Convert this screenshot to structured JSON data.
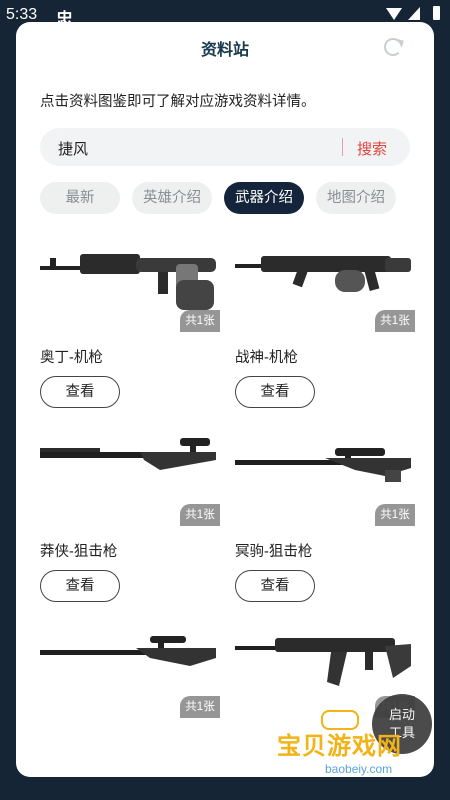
{
  "status": {
    "time": "5:33",
    "app_icon": "忠"
  },
  "header": {
    "title": "资料站"
  },
  "desc": "点击资料图鉴即可了解对应游戏资料详情。",
  "search": {
    "query": "捷风",
    "button": "搜索"
  },
  "tabs": [
    {
      "label": "最新",
      "active": false
    },
    {
      "label": "英雄介绍",
      "active": false
    },
    {
      "label": "武器介绍",
      "active": true
    },
    {
      "label": "地图介绍",
      "active": false
    }
  ],
  "items": [
    {
      "name": "奥丁-机枪",
      "count": "共1张",
      "button": "查看",
      "icon": "machine-gun"
    },
    {
      "name": "战神-机枪",
      "count": "共1张",
      "button": "查看",
      "icon": "machine-gun"
    },
    {
      "name": "莽侠-狙击枪",
      "count": "共1张",
      "button": "查看",
      "icon": "sniper-rifle"
    },
    {
      "name": "冥驹-狙击枪",
      "count": "共1张",
      "button": "查看",
      "icon": "sniper-rifle"
    },
    {
      "name": "",
      "count": "共1张",
      "button": "",
      "icon": "sniper-rifle"
    },
    {
      "name": "",
      "count": "共1张",
      "button": "",
      "icon": "assault-rifle"
    }
  ],
  "floating": {
    "line1": "启动",
    "line2": "工具"
  },
  "watermark": {
    "text": "宝贝游戏网",
    "url": "baobeiy.com",
    "color": "#f2b319"
  }
}
